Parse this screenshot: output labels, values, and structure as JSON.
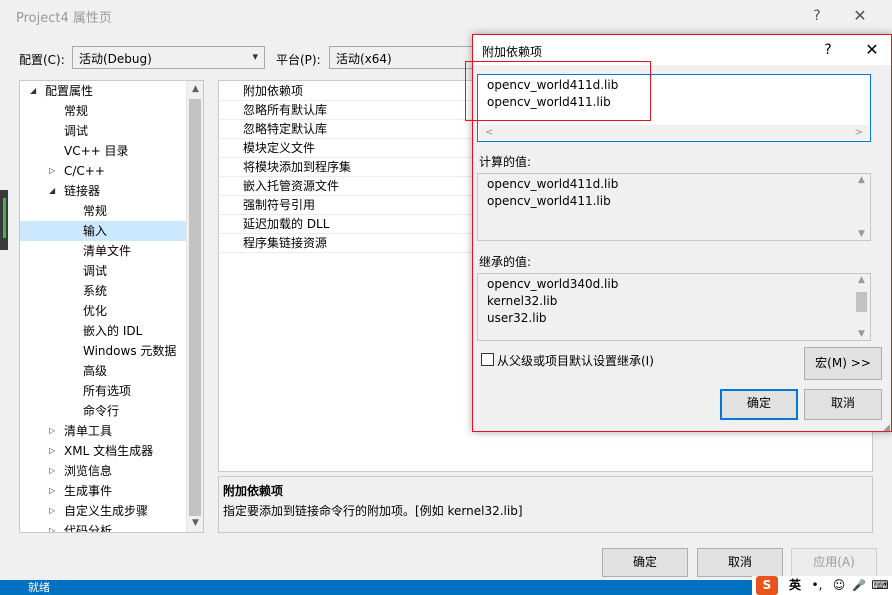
{
  "window": {
    "title": "Project4 属性页",
    "help_glyph": "?",
    "close_glyph": "✕"
  },
  "config": {
    "config_label": "配置(C):",
    "config_value": "活动(Debug)",
    "platform_label": "平台(P):",
    "platform_value": "活动(x64)"
  },
  "tree": {
    "items": [
      {
        "label": "配置属性",
        "expanded": true
      },
      {
        "label": "常规"
      },
      {
        "label": "调试"
      },
      {
        "label": "VC++ 目录"
      },
      {
        "label": "C/C++",
        "expanded": false
      },
      {
        "label": "链接器",
        "expanded": true
      },
      {
        "label": "常规"
      },
      {
        "label": "输入",
        "selected": true
      },
      {
        "label": "清单文件"
      },
      {
        "label": "调试"
      },
      {
        "label": "系统"
      },
      {
        "label": "优化"
      },
      {
        "label": "嵌入的 IDL"
      },
      {
        "label": "Windows 元数据"
      },
      {
        "label": "高级"
      },
      {
        "label": "所有选项"
      },
      {
        "label": "命令行"
      },
      {
        "label": "清单工具",
        "expanded": false
      },
      {
        "label": "XML 文档生成器",
        "expanded": false
      },
      {
        "label": "浏览信息",
        "expanded": false
      },
      {
        "label": "生成事件",
        "expanded": false
      },
      {
        "label": "自定义生成步骤",
        "expanded": false
      },
      {
        "label": "代码分析",
        "expanded": false
      }
    ]
  },
  "grid": {
    "rows": [
      "附加依赖项",
      "忽略所有默认库",
      "忽略特定默认库",
      "模块定义文件",
      "将模块添加到程序集",
      "嵌入托管资源文件",
      "强制符号引用",
      "延迟加载的 DLL",
      "程序集链接资源"
    ]
  },
  "description": {
    "title": "附加依赖项",
    "text": "指定要添加到链接命令行的附加项。[例如 kernel32.lib]"
  },
  "buttons": {
    "ok": "确定",
    "cancel": "取消",
    "apply": "应用(A)"
  },
  "status": {
    "text": "就绪"
  },
  "ime": {
    "logo": "S",
    "lang": "英",
    "punct": "•,",
    "emoji": "☺",
    "mic": "🎤",
    "keyboard": "⌨"
  },
  "dialog": {
    "title": "附加依赖项",
    "help_glyph": "?",
    "close_glyph": "✕",
    "input_lines": [
      "opencv_world411d.lib",
      "opencv_world411.lib"
    ],
    "computed_label": "计算的值:",
    "computed_lines": [
      "opencv_world411d.lib",
      "opencv_world411.lib"
    ],
    "inherited_label": "继承的值:",
    "inherited_lines": [
      "opencv_world340d.lib",
      "kernel32.lib",
      "user32.lib"
    ],
    "inherit_checkbox_label": "从父级或项目默认设置继承(I)",
    "inherit_checked": false,
    "macro_button": "宏(M) >>",
    "ok": "确定",
    "cancel": "取消"
  },
  "colors": {
    "accent": "#0078d7",
    "highlight_border": "#e81123",
    "selection": "#cce8ff",
    "statusbar": "#0070c0"
  }
}
